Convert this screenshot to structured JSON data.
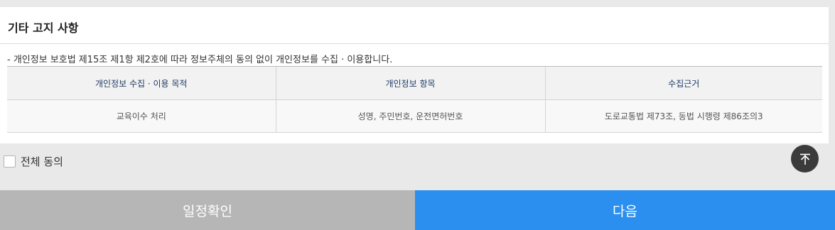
{
  "section": {
    "title": "기타 고지 사항",
    "notice": "- 개인정보 보호법 제15조 제1항 제2호에 따라 정보주체의 동의 없이 개인정보를 수집 · 이용합니다."
  },
  "table": {
    "headers": [
      "개인정보 수집 · 이용 목적",
      "개인정보 항목",
      "수집근거"
    ],
    "rows": [
      [
        "교육이수 처리",
        "성명, 주민번호, 운전면허번호",
        "도로교통법 제73조, 동법 시행령 제86조의3"
      ]
    ]
  },
  "agree": {
    "label": "전체 동의",
    "checked": false
  },
  "scroll_top": {
    "icon": "arrow-up-to-top-icon"
  },
  "buttons": {
    "schedule": "일정확인",
    "next": "다음"
  },
  "colors": {
    "next_button": "#2b8fef",
    "schedule_button": "#b6b6b6",
    "header_text": "#1f3b66"
  }
}
